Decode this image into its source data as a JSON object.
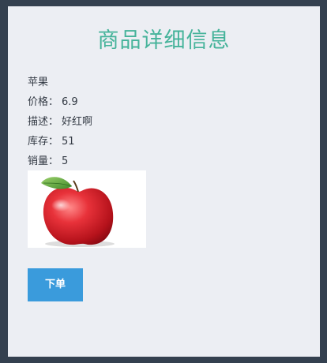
{
  "page": {
    "title": "商品详细信息"
  },
  "product": {
    "name": "苹果",
    "price_label": "价格：",
    "price_value": "6.9",
    "desc_label": "描述：",
    "desc_value": "好红啊",
    "stock_label": "库存：",
    "stock_value": "51",
    "sales_label": "销量：",
    "sales_value": "5",
    "image": "apple-photo"
  },
  "actions": {
    "order_label": "下单"
  },
  "colors": {
    "background": "#34404f",
    "panel": "#eceef3",
    "title": "#45b39a",
    "button": "#3a9bdc"
  }
}
